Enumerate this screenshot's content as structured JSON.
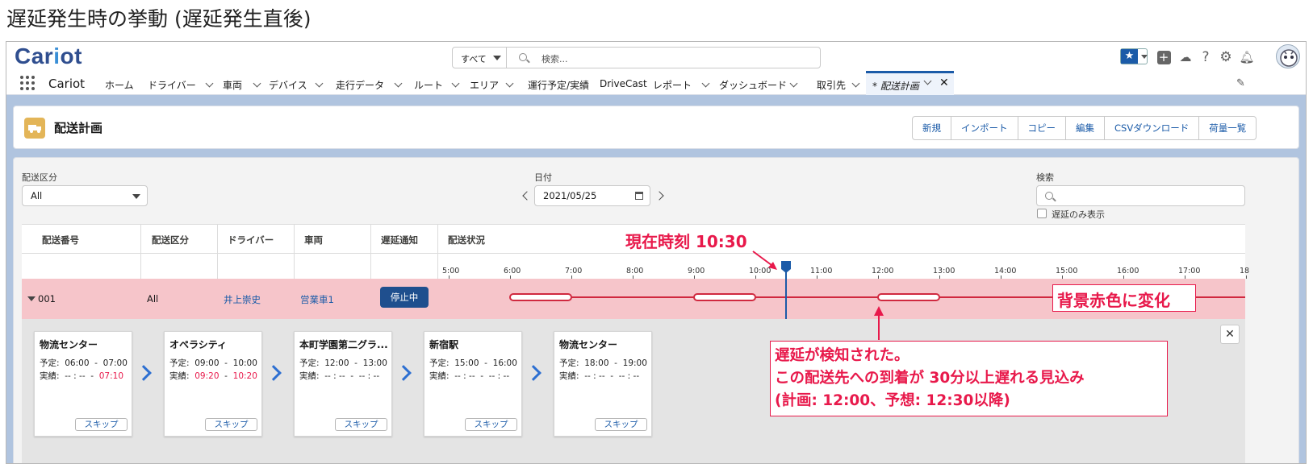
{
  "page_title": "遅延発生時の挙動 (遅延発生直後)",
  "app": {
    "logo": {
      "prefix": "Car",
      "o": "i",
      "suffix": "ot"
    },
    "search": {
      "scope": "すべて",
      "placeholder": "検索..."
    },
    "name": "Cariot",
    "nav": [
      {
        "label": "ホーム",
        "chevron": false
      },
      {
        "label": "ドライバー",
        "chevron": true
      },
      {
        "label": "車両",
        "chevron": true
      },
      {
        "label": "デバイス",
        "chevron": true
      },
      {
        "label": "走行データ",
        "chevron": true
      },
      {
        "label": "ルート",
        "chevron": true
      },
      {
        "label": "エリア",
        "chevron": true
      },
      {
        "label": "運行予定/実績",
        "chevron": false
      },
      {
        "label": "DriveCast",
        "chevron": false
      },
      {
        "label": "レポート",
        "chevron": true
      },
      {
        "label": "ダッシュボード",
        "chevron": true
      },
      {
        "label": "取引先",
        "chevron": true
      }
    ],
    "active_tab": "* 配送計画",
    "header_icons": [
      "star-icon",
      "add-icon",
      "trailhead-icon",
      "help-icon",
      "gear-icon",
      "bell-icon",
      "avatar"
    ]
  },
  "header": {
    "title": "配送計画",
    "buttons": [
      "新規",
      "インポート",
      "コピー",
      "編集",
      "CSVダウンロード",
      "荷量一覧"
    ]
  },
  "filters": {
    "kubun_label": "配送区分",
    "kubun_value": "All",
    "date_label": "日付",
    "date_value": "2021/05/25",
    "search_label": "検索",
    "delay_only_label": "遅延のみ表示"
  },
  "table": {
    "headers": [
      "配送番号",
      "配送区分",
      "ドライバー",
      "車両",
      "遅延通知",
      "配送状況"
    ],
    "timeline_ticks": [
      "5:00",
      "6:00",
      "7:00",
      "8:00",
      "9:00",
      "10:00",
      "11:00",
      "12:00",
      "13:00",
      "14:00",
      "15:00",
      "16:00",
      "17:00",
      "18"
    ],
    "row": {
      "number": "001",
      "kubun": "All",
      "driver": "井上崇史",
      "vehicle": "営業車1",
      "delay_button": "停止中",
      "current_time_hours": 10.5,
      "segments": [
        [
          6.0,
          7.0
        ],
        [
          9.0,
          10.0
        ],
        [
          12.0,
          13.0
        ]
      ]
    }
  },
  "stops": [
    {
      "name": "物流センター",
      "plan_label": "予定:",
      "plan": "06:00  -  07:00",
      "actual_label": "実績:",
      "actual_start": "-- : --",
      "actual_end": "07:10",
      "start_late": false,
      "end_late": true,
      "skip": "スキップ"
    },
    {
      "name": "オペラシティ",
      "plan_label": "予定:",
      "plan": "09:00  -  10:00",
      "actual_label": "実績:",
      "actual_start": "09:20",
      "actual_end": "10:20",
      "start_late": true,
      "end_late": true,
      "skip": "スキップ"
    },
    {
      "name": "本町学園第二グラ...",
      "plan_label": "予定:",
      "plan": "12:00  -  13:00",
      "actual_label": "実績:",
      "actual_start": "-- : --",
      "actual_end": "-- : --",
      "start_late": false,
      "end_late": false,
      "skip": "スキップ"
    },
    {
      "name": "新宿駅",
      "plan_label": "予定:",
      "plan": "15:00  -  16:00",
      "actual_label": "実績:",
      "actual_start": "-- : --",
      "actual_end": "-- : --",
      "start_late": false,
      "end_late": false,
      "skip": "スキップ"
    },
    {
      "name": "物流センター",
      "plan_label": "予定:",
      "plan": "18:00  -  19:00",
      "actual_label": "実績:",
      "actual_start": "-- : --",
      "actual_end": "-- : --",
      "start_late": false,
      "end_late": false,
      "skip": "スキップ"
    }
  ],
  "annotations": {
    "current_time": "現在時刻 10:30",
    "background": "背景赤色に変化",
    "detect_line1": "遅延が検知された。",
    "detect_line2": "この配送先への到着が 30分以上遅れる見込み",
    "detect_line3": "(計画: 12:00、予想: 12:30以降)"
  },
  "colors": {
    "accent": "#1b5ba8",
    "delay_row": "#f6c5ca",
    "annotation": "#e8194b",
    "timeline": "#d0293f",
    "late_text": "#e8194b"
  }
}
